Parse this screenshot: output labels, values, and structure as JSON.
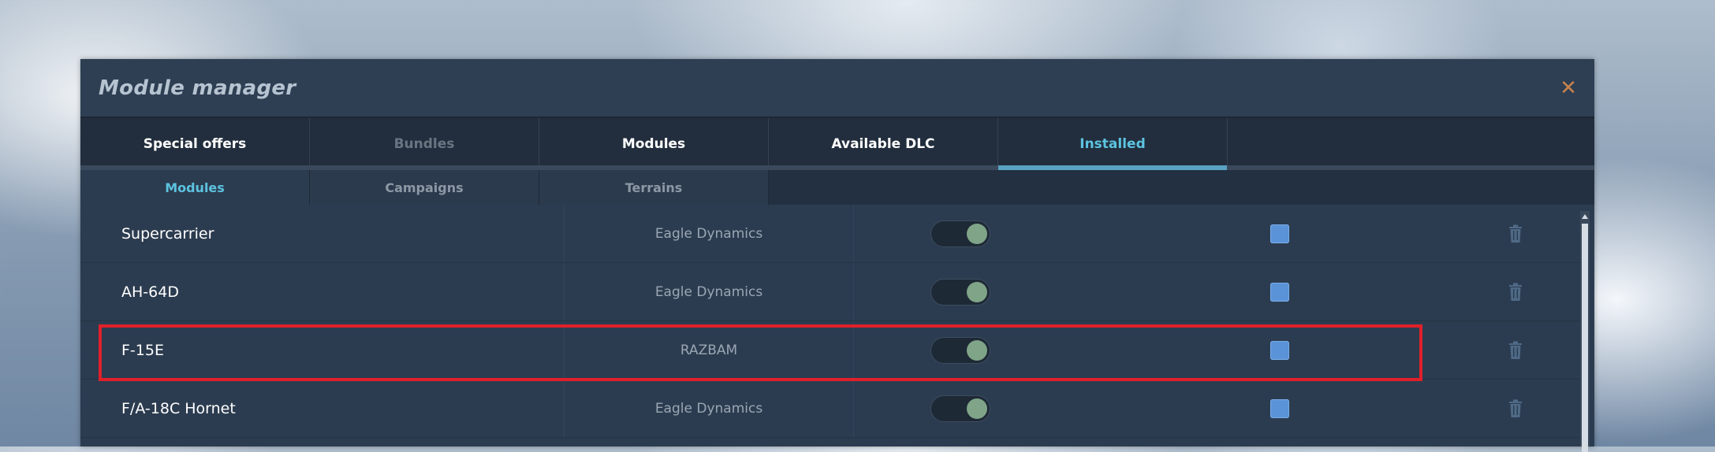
{
  "window": {
    "title": "Module manager"
  },
  "tabs": [
    {
      "label": "Special offers",
      "state": "normal"
    },
    {
      "label": "Bundles",
      "state": "disabled"
    },
    {
      "label": "Modules",
      "state": "normal"
    },
    {
      "label": "Available DLC",
      "state": "normal"
    },
    {
      "label": "Installed",
      "state": "active"
    }
  ],
  "subtabs": [
    {
      "label": "Modules",
      "state": "active"
    },
    {
      "label": "Campaigns",
      "state": "normal"
    },
    {
      "label": "Terrains",
      "state": "normal"
    }
  ],
  "modules": [
    {
      "name": "Supercarrier",
      "developer": "Eagle Dynamics",
      "enabled": true,
      "checked": true
    },
    {
      "name": "AH-64D",
      "developer": "Eagle Dynamics",
      "enabled": true,
      "checked": true
    },
    {
      "name": "F-15E",
      "developer": "RAZBAM",
      "enabled": true,
      "checked": true,
      "highlighted": true
    },
    {
      "name": "F/A-18C Hornet",
      "developer": "Eagle Dynamics",
      "enabled": true,
      "checked": true
    }
  ],
  "icons": {
    "close": "close-icon",
    "delete": "trash-icon",
    "scroll_up": "arrow-up-icon"
  },
  "colors": {
    "accent": "#5cc3e0",
    "highlight": "#e0202a",
    "toggle_on": "#7fa487",
    "checkbox": "#5b93d8",
    "close": "#c8824a"
  }
}
